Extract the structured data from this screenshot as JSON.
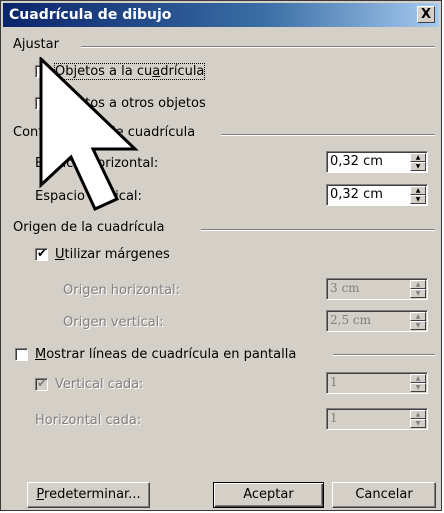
{
  "window": {
    "title": "Cuadrícula de dibujo",
    "close": "X"
  },
  "groups": {
    "ajustar": "Ajustar",
    "config": "Configuración de cuadrícula",
    "origen": "Origen de la cuadrícula"
  },
  "ajustar": {
    "objetos_cuadricula": {
      "pre": "Objetos a la cu",
      "u": "a",
      "post": "drícula",
      "checked": false
    },
    "otros_objetos": {
      "label": "Objetos a otros objetos",
      "checked": false
    }
  },
  "config": {
    "horizontal": {
      "label": "Espacio horizontal:",
      "value": "0,32 cm"
    },
    "vertical": {
      "label": "Espacio vertical:",
      "value": "0,32 cm"
    }
  },
  "origen": {
    "utilizar_margenes": {
      "u": "U",
      "post": "tilizar márgenes",
      "checked": true,
      "check_glyph": "✔"
    },
    "horizontal": {
      "label": "Origen horizontal:",
      "value": "3 cm"
    },
    "vertical": {
      "label": "Origen vertical:",
      "value": "2,5 cm"
    }
  },
  "mostrar": {
    "u": "M",
    "post": "ostrar líneas de cuadrícula en pantalla",
    "checked": false,
    "vertical_cada": {
      "label": "Vertical cada:",
      "checked": true,
      "check_glyph": "✔",
      "value": "1"
    },
    "horizontal_cada": {
      "label": "Horizontal cada:",
      "value": "1"
    }
  },
  "buttons": {
    "predeterminar": {
      "u": "P",
      "post": "redeterminar..."
    },
    "aceptar": "Aceptar",
    "cancelar": "Cancelar"
  },
  "spin_glyphs": {
    "up": "▲",
    "down": "▼"
  }
}
